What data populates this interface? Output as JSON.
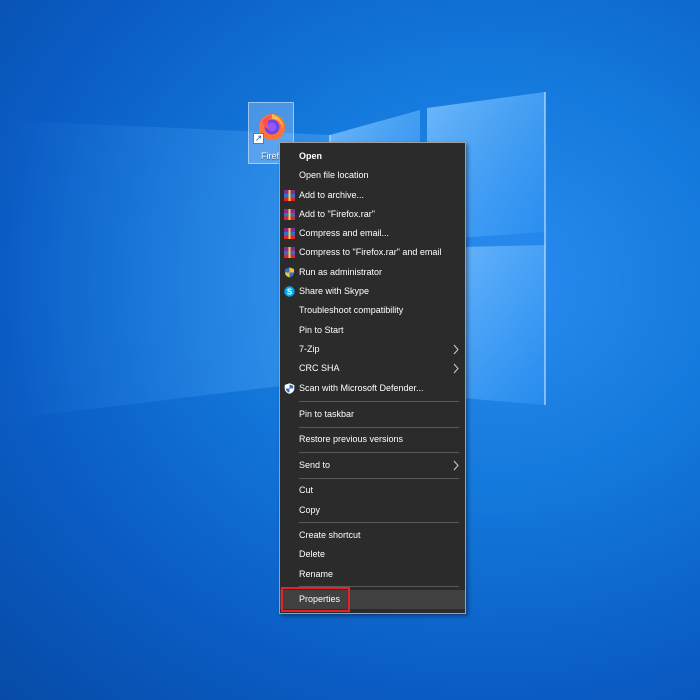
{
  "desktop": {
    "icon_label": "Firefox"
  },
  "context_menu": {
    "items": [
      {
        "label": "Open",
        "bold": true,
        "icon": "",
        "submenu": false
      },
      {
        "label": "Open file location",
        "icon": "",
        "submenu": false
      },
      {
        "label": "Add to archive...",
        "icon": "winrar-icon",
        "submenu": false
      },
      {
        "label": "Add to \"Firefox.rar\"",
        "icon": "winrar-icon",
        "submenu": false
      },
      {
        "label": "Compress and email...",
        "icon": "winrar-icon",
        "submenu": false
      },
      {
        "label": "Compress to \"Firefox.rar\" and email",
        "icon": "winrar-icon",
        "submenu": false
      },
      {
        "label": "Run as administrator",
        "icon": "uac-shield-icon",
        "submenu": false
      },
      {
        "label": "Share with Skype",
        "icon": "skype-icon",
        "submenu": false
      },
      {
        "label": "Troubleshoot compatibility",
        "icon": "",
        "submenu": false
      },
      {
        "label": "Pin to Start",
        "icon": "",
        "submenu": false
      },
      {
        "label": "7-Zip",
        "icon": "",
        "submenu": true
      },
      {
        "label": "CRC SHA",
        "icon": "",
        "submenu": true
      },
      {
        "label": "Scan with Microsoft Defender...",
        "icon": "defender-icon",
        "submenu": false
      },
      {
        "label": "Pin to taskbar",
        "icon": "",
        "submenu": false
      },
      {
        "label": "Restore previous versions",
        "icon": "",
        "submenu": false
      },
      {
        "label": "Send to",
        "icon": "",
        "submenu": true
      },
      {
        "label": "Cut",
        "icon": "",
        "submenu": false
      },
      {
        "label": "Copy",
        "icon": "",
        "submenu": false
      },
      {
        "label": "Create shortcut",
        "icon": "",
        "submenu": false
      },
      {
        "label": "Delete",
        "icon": "",
        "submenu": false
      },
      {
        "label": "Rename",
        "icon": "",
        "submenu": false
      },
      {
        "label": "Properties",
        "icon": "",
        "submenu": false,
        "highlighted": true
      }
    ]
  },
  "colors": {
    "menu_background": "#2b2b2b",
    "menu_text": "#ffffff",
    "highlight_outline": "#e8202a",
    "desktop_blue": "#1479dc"
  }
}
